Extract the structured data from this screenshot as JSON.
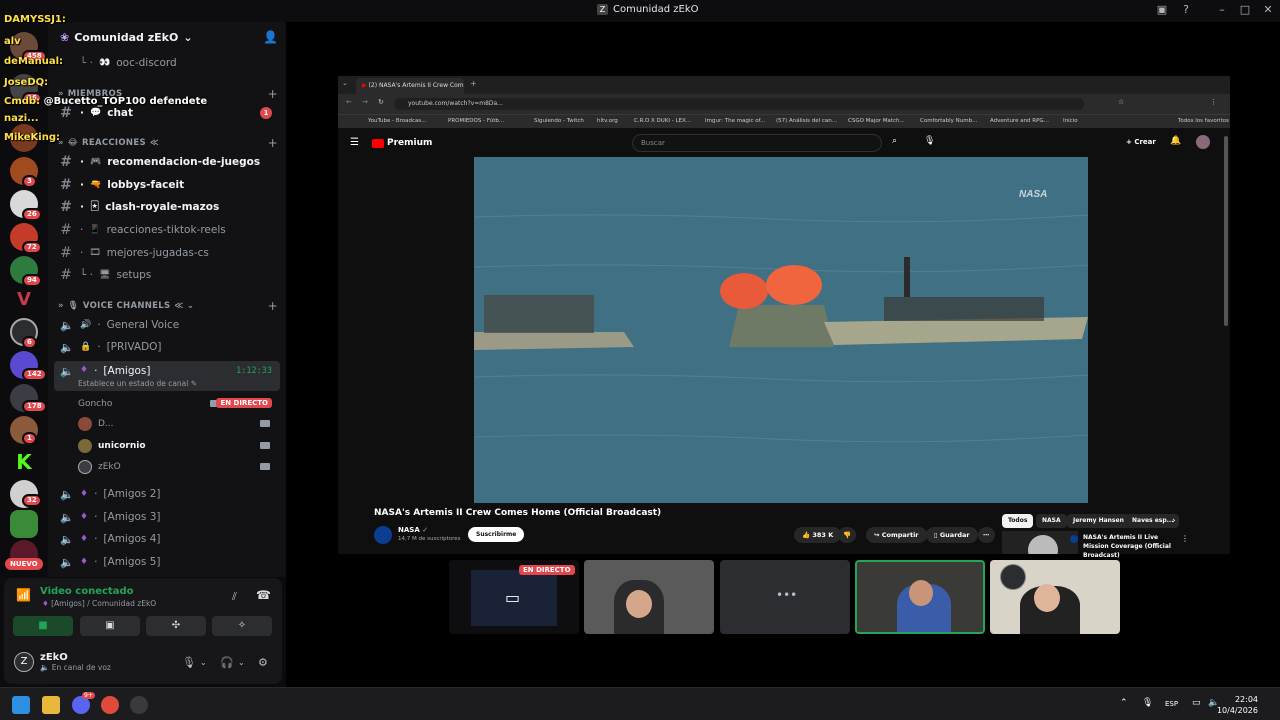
{
  "window": {
    "title": "Comunidad zEkO",
    "controls": [
      "mailbox-icon",
      "help-icon",
      "minimize",
      "maximize",
      "close"
    ]
  },
  "overlay_chat": [
    {
      "name": "DAMYSSJ1:",
      "text": ""
    },
    {
      "name": "alv",
      "text": ""
    },
    {
      "name": "deManual:",
      "text": ""
    },
    {
      "name": "JoseDQ:",
      "text": ""
    },
    {
      "name": "Cmdb:",
      "text": "@Bucetto_TOP100 defendete"
    },
    {
      "name": "nazi...",
      "text": ""
    },
    {
      "name": "MikeKing:",
      "text": ""
    }
  ],
  "server": {
    "name": "Comunidad zEkO",
    "channels": [
      {
        "name": "ooc-discord",
        "emoji": "👀"
      },
      {
        "name": "chat",
        "emoji": "💬",
        "bold": true,
        "unread": "1"
      },
      {
        "name": "recomendacion-de-juegos",
        "emoji": "🎮",
        "bold": true
      },
      {
        "name": "lobbys-faceit",
        "emoji": "🔫",
        "bold": true
      },
      {
        "name": "clash-royale-mazos",
        "emoji": "🃏",
        "bold": true
      },
      {
        "name": "reacciones-tiktok-reels",
        "emoji": "📱"
      },
      {
        "name": "mejores-jugadas-cs",
        "emoji": "🎞"
      },
      {
        "name": "setups",
        "emoji": "🖥"
      }
    ],
    "categories": {
      "miembros": "MIEMBROS",
      "reacciones": "REACCIONES",
      "voice": "VOICE CHANNELS"
    },
    "voice_channels": [
      {
        "name": "General Voice"
      },
      {
        "name": "[PRIVADO]"
      },
      {
        "name": "[Amigos]",
        "timer": "1:12:33",
        "status": "Establece un estado de canal"
      },
      {
        "name": "[Amigos 2]"
      },
      {
        "name": "[Amigos 3]"
      },
      {
        "name": "[Amigos 4]"
      },
      {
        "name": "[Amigos 5]"
      }
    ],
    "members": [
      {
        "name": "Goncho",
        "live": "EN DIRECTO"
      },
      {
        "name": "D..."
      },
      {
        "name": "unicornio",
        "bold": true
      },
      {
        "name": "zEkO"
      }
    ]
  },
  "rail": {
    "badges": [
      "458",
      "26",
      "3",
      "26",
      "72",
      "94",
      "6",
      "142",
      "178",
      "1",
      "32"
    ],
    "nuevo": "NUEVO"
  },
  "voice_panel": {
    "title": "Video conectado",
    "subtitle": "[Amigos] / Comunidad zEkO",
    "user": "zEkO",
    "user_status": "En canal de voz"
  },
  "browser": {
    "tab_title": "(2) NASA's Artemis II Crew Com",
    "url": "youtube.com/watch?v=m8Da...",
    "bookmarks": [
      "YouTube - Broadcas...",
      "PROMIEDOS - Fútb...",
      "Siguiendo - Twitch",
      "hltv.org",
      "C.R.O X DUKI - LEX...",
      "Imgur: The magic of...",
      "(57) Análisis del can...",
      "CSGO Major Match...",
      "Comfortably Numb...",
      "Adventure and RPG...",
      "Inicio",
      "Todos los favoritos"
    ],
    "yt_logo": "Premium",
    "search_placeholder": "Buscar",
    "crear": "Crear",
    "video_title": "NASA's Artemis II Crew Comes Home (Official Broadcast)",
    "channel": "NASA",
    "subs": "14,7 M de suscriptores",
    "subscribe": "Suscribirme",
    "likes": "383 K",
    "share": "Compartir",
    "save": "Guardar",
    "chips": [
      "Todos",
      "NASA",
      "Jeremy Hansen",
      "Naves esp..."
    ],
    "rec_title": "NASA's Artemis II Live Mission Coverage (Official Broadcast)",
    "watermark": "NASA"
  },
  "streams": {
    "live_label": "EN DIRECTO"
  },
  "taskbar": {
    "lang": "ESP",
    "time": "22:04",
    "date": "10/4/2026",
    "discord_badge": "9+"
  },
  "colors": {
    "discord_bg": "#121214",
    "green": "#23a559",
    "red": "#e0484c",
    "youtube_red": "#ff0000"
  }
}
